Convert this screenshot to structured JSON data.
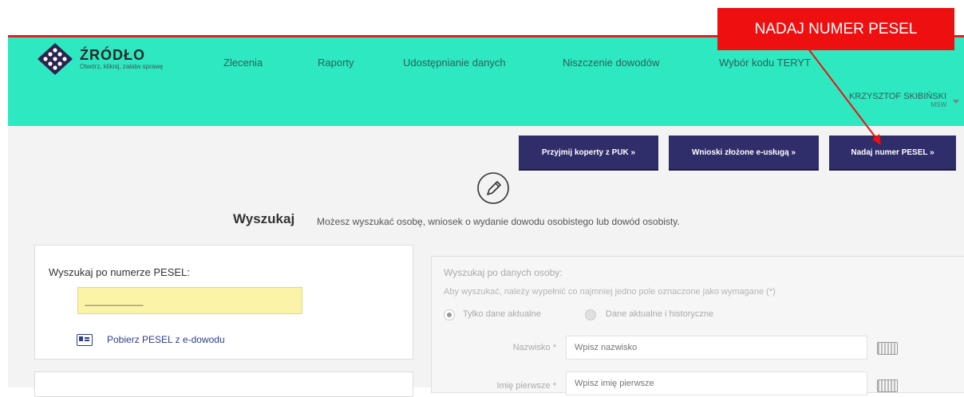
{
  "app": {
    "brand_name": "ŹRÓDŁO",
    "brand_tagline": "Otwórz, kliknij, załatw sprawę"
  },
  "nav": [
    "Zlecenia",
    "Raporty",
    "Udostępnianie danych",
    "Niszczenie dowodów",
    "Wybór kodu TERYT"
  ],
  "user": {
    "name": "KRZYSZTOF SKIBIŃSKI",
    "org": "MSW"
  },
  "actions": {
    "btn1": "Przyjmij koperty z PUK »",
    "btn2": "Wnioski złożone e-usługą »",
    "btn3": "Nadaj numer PESEL »"
  },
  "search": {
    "title": "Wyszukaj",
    "description": "Możesz wyszukać osobę, wniosek o wydanie dowodu osobistego lub dowód osobisty."
  },
  "pesel_panel": {
    "title": "Wyszukaj po numerze PESEL:",
    "input_value": "___________",
    "link": "Pobierz PESEL z e-dowodu"
  },
  "person_panel": {
    "title": "Wyszukaj po danych osoby:",
    "info": "Aby wyszukać, należy wypełnić co najmniej jedno pole oznaczone jako wymagane (*)",
    "radio1": "Tylko dane aktualne",
    "radio2": "Dane aktualne i historyczne",
    "field1_label": "Nazwisko *",
    "field1_placeholder": "Wpisz nazwisko",
    "field2_label": "Imię pierwsze *",
    "field2_placeholder": "Wpisz imię pierwsze"
  },
  "annotation": {
    "label": "NADAJ NUMER PESEL"
  },
  "colors": {
    "header": "#2ee8c2",
    "button": "#2f2d6a",
    "annotation": "#ee1010",
    "pesel_input": "#faf3a8"
  }
}
